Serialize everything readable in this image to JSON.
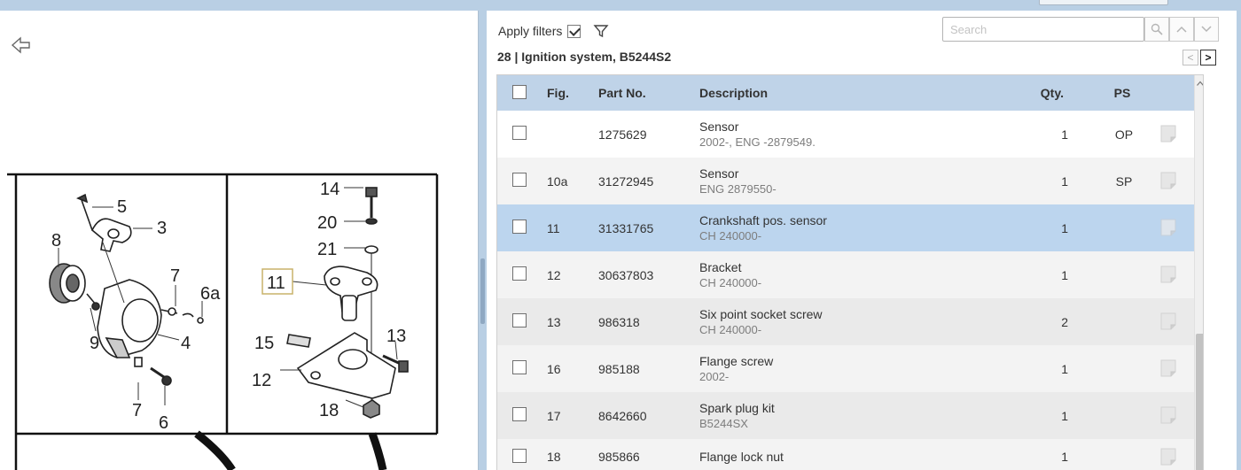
{
  "left": {
    "back_icon": "back-arrow-icon",
    "callouts": [
      "5",
      "3",
      "8",
      "7",
      "6a",
      "9",
      "4",
      "7",
      "6",
      "14",
      "20",
      "21",
      "11",
      "15",
      "13",
      "12",
      "18"
    ]
  },
  "toolbar": {
    "apply_filters_label": "Apply filters",
    "apply_filters_checked": true,
    "filter_icon": "funnel-icon",
    "search_placeholder": "Search",
    "search_value": "",
    "search_icon": "magnifier-icon",
    "prev_icon": "chevron-up-icon",
    "next_icon": "chevron-down-icon"
  },
  "breadcrumb": "28  |  Ignition system, B5244S2",
  "pager": {
    "prev": "<",
    "next": ">"
  },
  "table": {
    "columns": [
      "Fig.",
      "Part No.",
      "Description",
      "Qty.",
      "PS"
    ],
    "rows": [
      {
        "fig": "",
        "part": "1275629",
        "desc": "Sensor",
        "sub": "2002-, ENG -2879549.",
        "qty": "1",
        "ps": "OP",
        "selected": false
      },
      {
        "fig": "10a",
        "part": "31272945",
        "desc": "Sensor",
        "sub": "ENG 2879550-",
        "qty": "1",
        "ps": "SP",
        "selected": false
      },
      {
        "fig": "11",
        "part": "31331765",
        "desc": "Crankshaft pos. sensor",
        "sub": "CH 240000-",
        "qty": "1",
        "ps": "",
        "selected": true
      },
      {
        "fig": "12",
        "part": "30637803",
        "desc": "Bracket",
        "sub": "CH 240000-",
        "qty": "1",
        "ps": "",
        "selected": false
      },
      {
        "fig": "13",
        "part": "986318",
        "desc": "Six point socket screw",
        "sub": "CH 240000-",
        "qty": "2",
        "ps": "",
        "selected": false
      },
      {
        "fig": "16",
        "part": "985188",
        "desc": "Flange screw",
        "sub": "2002-",
        "qty": "1",
        "ps": "",
        "selected": false
      },
      {
        "fig": "17",
        "part": "8642660",
        "desc": "Spark plug kit",
        "sub": "B5244SX",
        "qty": "1",
        "ps": "",
        "selected": false
      },
      {
        "fig": "18",
        "part": "985866",
        "desc": "Flange lock nut",
        "sub": "",
        "qty": "1",
        "ps": "",
        "selected": false
      }
    ]
  },
  "colors": {
    "frame": "#b9cfe4",
    "header_bg": "#bfd3e8",
    "selected_row": "#bcd5ee",
    "alt_row": "#f3f3f3"
  }
}
